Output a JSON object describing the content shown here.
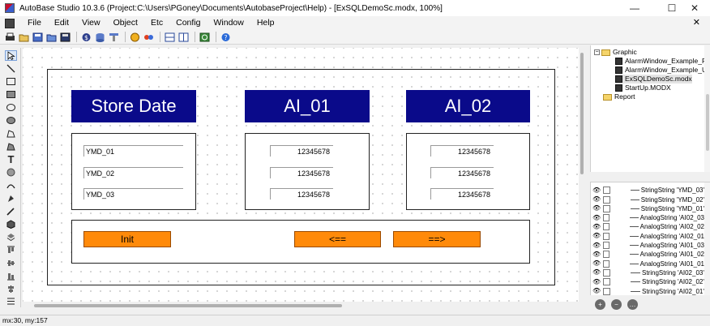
{
  "window": {
    "title": "AutoBase Studio 10.3.6 (Project:C:\\Users\\PGoney\\Documents\\AutobaseProject\\Help) - [ExSQLDemoSc.modx, 100%]",
    "minimize_glyph": "—",
    "maximize_glyph": "☐",
    "close_glyph": "✕"
  },
  "menu": {
    "items": [
      "File",
      "Edit",
      "View",
      "Object",
      "Etc",
      "Config",
      "Window",
      "Help"
    ],
    "close_glyph": "✕"
  },
  "toolbar": {
    "icons": [
      "print-icon",
      "open-folder-icon",
      "save-as-icon",
      "open-icon",
      "save-icon",
      "tag-icon",
      "database-icon",
      "pen-icon",
      "image-icon",
      "palette-icon",
      "layout-icon",
      "window-icon",
      "refresh-icon",
      "help-icon"
    ]
  },
  "palette": {
    "tools": [
      "pointer-icon",
      "line-icon",
      "rectangle-icon",
      "filled-rectangle-icon",
      "ellipse-icon",
      "filled-ellipse-icon",
      "polygon-icon",
      "filled-polygon-icon",
      "text-icon",
      "circle-icon",
      "arc-icon",
      "fill-icon",
      "picker-icon",
      "cube-icon",
      "layers-icon",
      "align-top-icon",
      "align-middle-icon",
      "align-bottom-icon",
      "align-center-icon",
      "distribute-icon"
    ]
  },
  "canvas": {
    "headers": [
      "Store Date",
      "AI_01",
      "AI_02"
    ],
    "date_fields": [
      "YMD_01",
      "YMD_02",
      "YMD_03"
    ],
    "ai01_values": [
      "12345678",
      "12345678",
      "12345678"
    ],
    "ai02_values": [
      "12345678",
      "12345678",
      "12345678"
    ],
    "buttons": {
      "init": "Init",
      "prev": "<==",
      "next": "==>"
    }
  },
  "tree": {
    "root": "Graphic",
    "items": [
      "AlarmWindow_Example_Filt",
      "AlarmWindow_Example_UI.n",
      "ExSQLDemoSc.modx",
      "StartUp.MODX"
    ],
    "report": "Report"
  },
  "tags": [
    "StringString 'YMD_03'",
    "StringString 'YMD_02'",
    "StringString 'YMD_01'",
    "AnalogString 'AI02_03",
    "AnalogString 'AI02_02",
    "AnalogString 'AI02_01",
    "AnalogString 'AI01_03",
    "AnalogString 'AI01_02",
    "AnalogString 'AI01_01",
    "StringString 'AI02_03'",
    "StringString 'AI02_02'",
    "StringString 'AI02_01'"
  ],
  "status": {
    "coords": "mx:30, my:157"
  },
  "colors": {
    "header_bg": "#0a0a8a",
    "button_bg": "#ff8a0a"
  }
}
